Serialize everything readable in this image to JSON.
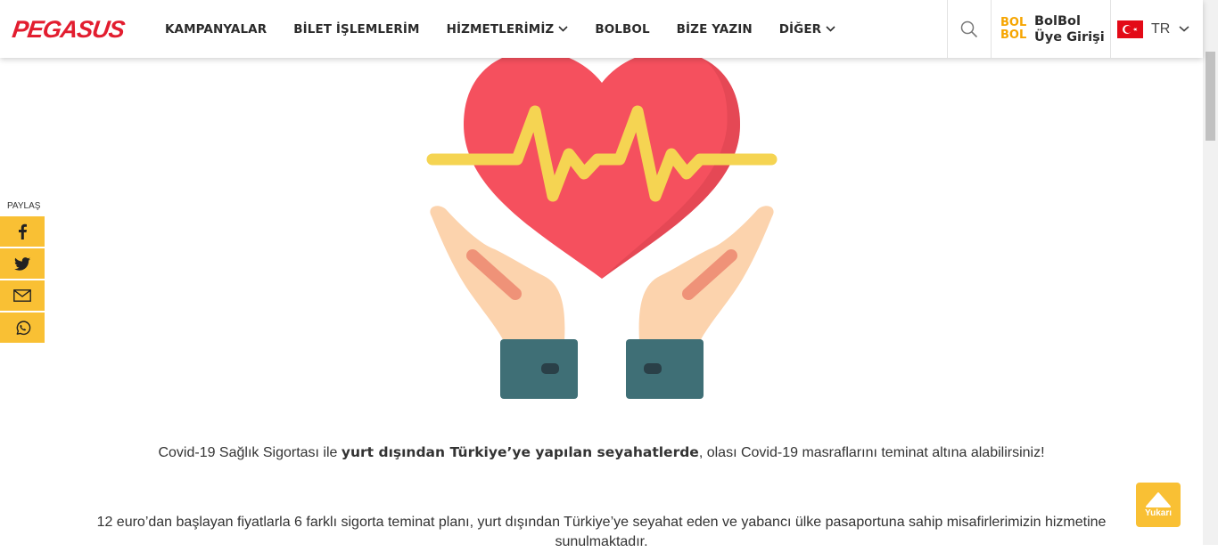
{
  "header": {
    "logo": "PEGASUS",
    "nav": [
      {
        "label": "KAMPANYALAR",
        "has_dropdown": false
      },
      {
        "label": "BİLET İŞLEMLERİM",
        "has_dropdown": false
      },
      {
        "label": "HİZMETLERİMİZ",
        "has_dropdown": true
      },
      {
        "label": "BOLBOL",
        "has_dropdown": false
      },
      {
        "label": "BİZE YAZIN",
        "has_dropdown": false
      },
      {
        "label": "DİĞER",
        "has_dropdown": true
      }
    ],
    "search_icon": "search-icon",
    "bolbol": {
      "logo_line1": "BOL",
      "logo_line2": "BOL",
      "line1": "BolBol",
      "line2": "Üye Girişi"
    },
    "language": {
      "code": "TR",
      "flag": "turkey-flag-icon"
    }
  },
  "share": {
    "label": "PAYLAŞ",
    "buttons": [
      "facebook-icon",
      "twitter-icon",
      "mail-icon",
      "whatsapp-icon"
    ]
  },
  "content": {
    "p1_before": "Covid-19 Sağlık Sigortası ile ",
    "p1_bold": "yurt dışından Türkiye’ye yapılan seyahatlerde",
    "p1_after": ", olası Covid-19 masraflarını teminat altına alabilirsiniz!",
    "p2": "12 euro’dan başlayan fiyatlarla 6 farklı sigorta teminat planı, yurt dışından Türkiye’ye seyahat eden ve yabancı ülke pasaportuna sahip misafirlerimizin hizmetine sunulmaktadır."
  },
  "up_button": {
    "label": "Yukarı"
  },
  "colors": {
    "brand_red": "#e21d2f",
    "accent_yellow": "#f9c034"
  }
}
